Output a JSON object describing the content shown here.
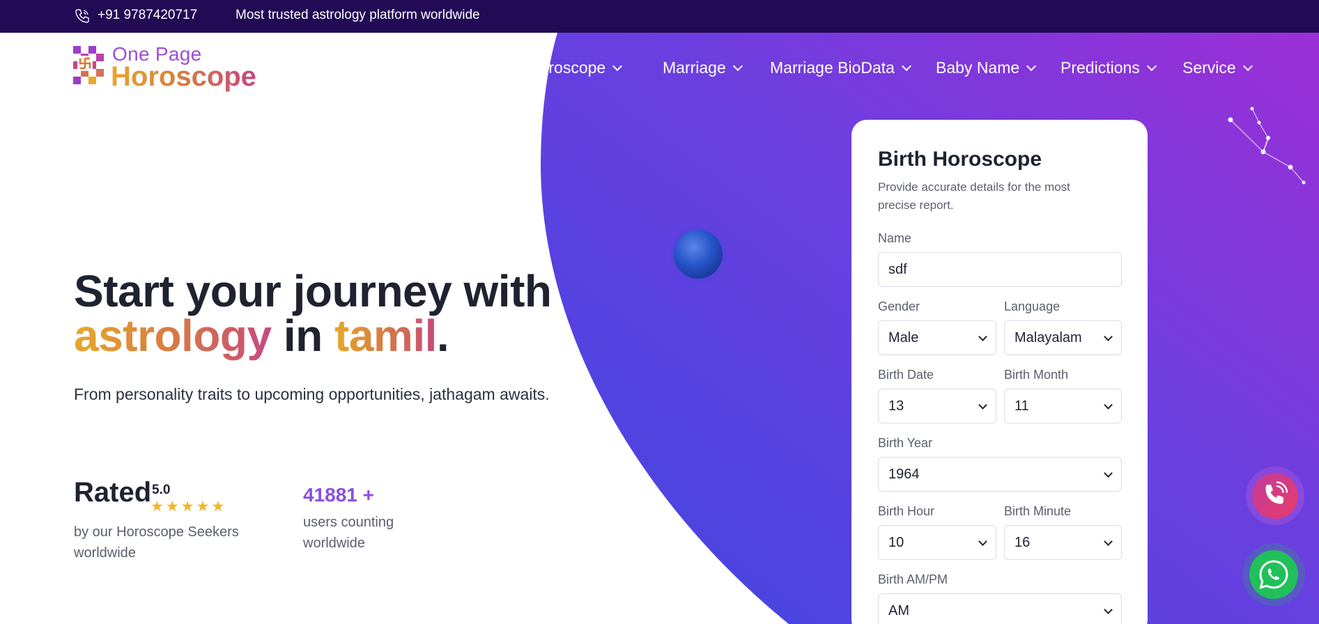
{
  "topbar": {
    "phone": "+91 9787420717",
    "tagline": "Most trusted astrology platform worldwide"
  },
  "logo": {
    "line1": "One Page",
    "line2": "Horoscope"
  },
  "nav": {
    "items": [
      {
        "label": "Horoscope"
      },
      {
        "label": "Marriage"
      },
      {
        "label": "Marriage BioData"
      },
      {
        "label": "Baby Name"
      },
      {
        "label": "Predictions"
      },
      {
        "label": "Service"
      }
    ]
  },
  "hero": {
    "title_part1": "Start your journey with",
    "title_highlight1": "astrology",
    "title_middle": " in ",
    "title_highlight2": "tamil",
    "title_end": ".",
    "subtitle": "From personality traits to upcoming opportunities, jathagam awaits."
  },
  "stats": {
    "rated_word": "Rated",
    "rating": "5.0",
    "stars": 5,
    "rated_desc": "by our Horoscope Seekers worldwide",
    "users_count": "41881 +",
    "users_desc": "users counting worldwide"
  },
  "form": {
    "title": "Birth Horoscope",
    "subtitle": "Provide accurate details for the most precise report.",
    "name_label": "Name",
    "name_value": "sdf",
    "gender_label": "Gender",
    "gender_value": "Male",
    "language_label": "Language",
    "language_value": "Malayalam",
    "date_label": "Birth Date",
    "date_value": "13",
    "month_label": "Birth Month",
    "month_value": "11",
    "year_label": "Birth Year",
    "year_value": "1964",
    "hour_label": "Birth Hour",
    "hour_value": "10",
    "minute_label": "Birth Minute",
    "minute_value": "16",
    "ampm_label": "Birth AM/PM",
    "ampm_value": "AM"
  },
  "colors": {
    "topbar": "#220a55",
    "hero_gradient_start": "#4a3fe0",
    "hero_gradient_end": "#9a2fd6",
    "accent_orange": "#e7a82b",
    "accent_pink": "#c64980",
    "accent_purple": "#8a4fe0",
    "whatsapp": "#21c05a"
  },
  "icons": {
    "phone": "phone-icon",
    "call": "phone-call-icon",
    "whatsapp": "whatsapp-icon",
    "chevron": "chevron-down-icon"
  }
}
